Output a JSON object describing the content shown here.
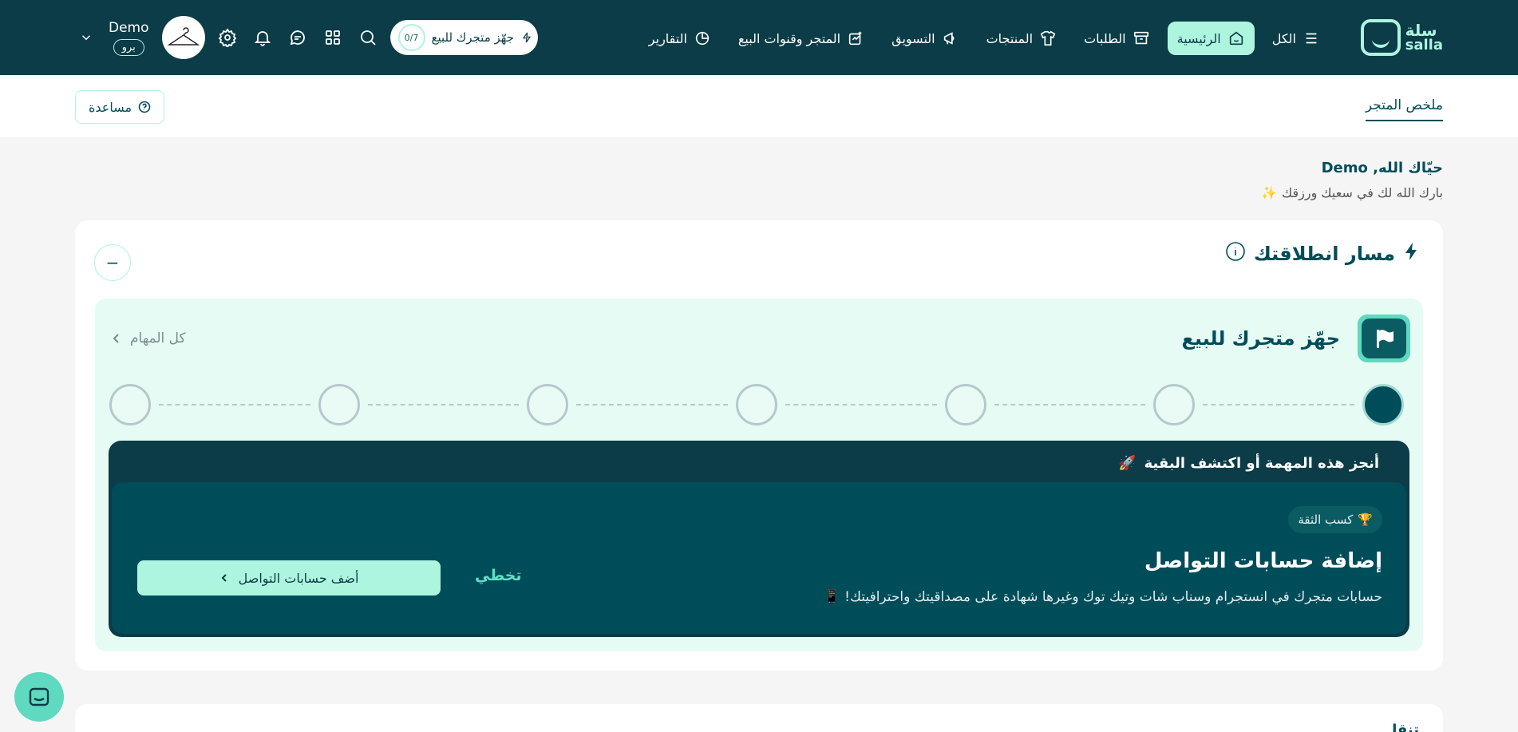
{
  "brand": {
    "name_ar": "سلة",
    "name_en": "salla"
  },
  "nav": {
    "items": [
      {
        "label": "الكل",
        "icon": "menu-icon"
      },
      {
        "label": "الرئيسية",
        "icon": "home-icon",
        "active": true
      },
      {
        "label": "الطلبات",
        "icon": "orders-box-icon"
      },
      {
        "label": "المنتجات",
        "icon": "shirt-icon"
      },
      {
        "label": "التسويق",
        "icon": "megaphone-icon"
      },
      {
        "label": "المتجر وقنوات البيع",
        "icon": "store-channels-icon"
      },
      {
        "label": "التقارير",
        "icon": "pie-chart-icon"
      }
    ],
    "ready_pill": {
      "label": "جهّز متجرك للبيع",
      "count": "0/7"
    },
    "user": {
      "name": "Demo",
      "badge": "برو"
    }
  },
  "subheader": {
    "tab": "ملخص المتجر",
    "help": "مساعدة"
  },
  "greeting": {
    "title": "حيّاك الله, Demo",
    "subtitle": "بارك الله لك في سعيك ورزقك",
    "subtitle_emoji": "✨"
  },
  "launch": {
    "title": "مسار انطلاقتك",
    "collapse": "−",
    "ready_title": "جهّز متجرك للبيع",
    "all_tasks": "كل المهام",
    "steps_total": 7,
    "current_step": 1,
    "task_header": "أنجز هذه المهمة أو اكتشف البقية",
    "task_header_emoji": "🚀",
    "task": {
      "chip": "كسب الثقة",
      "chip_emoji": "🏆",
      "title": "إضافة حسابات التواصل",
      "description": "حسابات متجرك في انستجرام وسناب شات وتيك توك وغيرها شهادة على مصداقيتك واحترافيتك! 📱",
      "skip": "تخطي",
      "action": "أضف حسابات التواصل"
    }
  },
  "next_card": {
    "title": "تنقل"
  },
  "colors": {
    "nav_bg": "#0b3c47",
    "accent_mint": "#aef5e0",
    "panel_mint": "#e7fbf5",
    "primary_text": "#004d5a",
    "task_bg": "#004d5a"
  }
}
